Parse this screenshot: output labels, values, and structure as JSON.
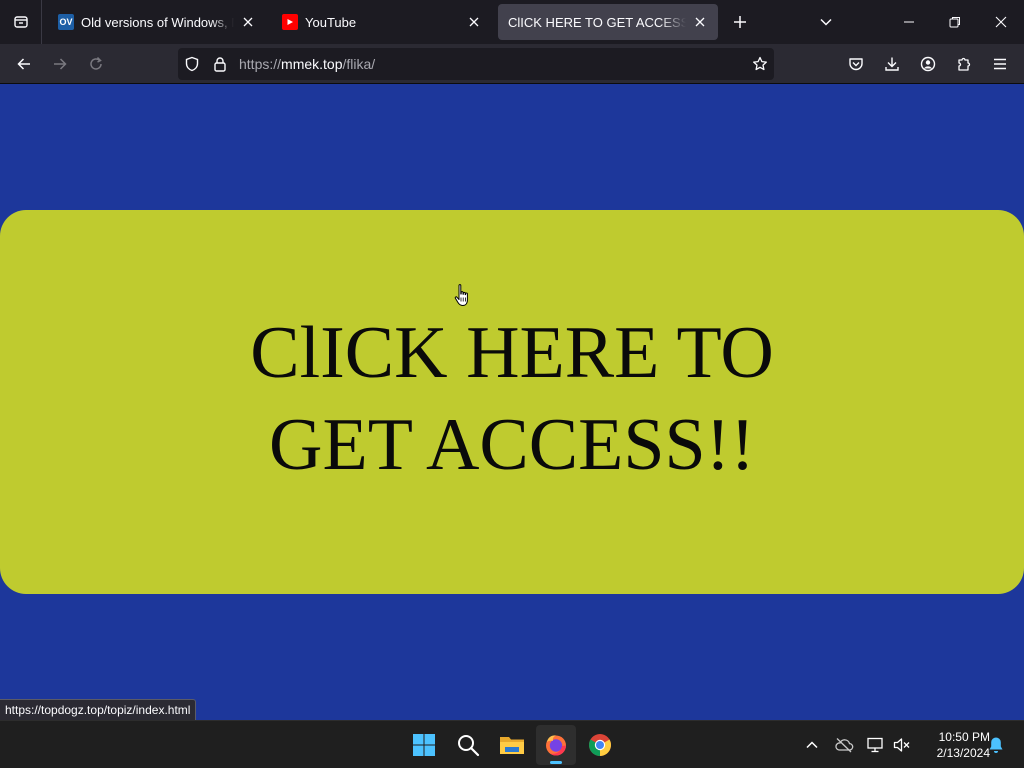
{
  "browser": {
    "tabs": [
      {
        "title": "Old versions of Windows, Mac and",
        "favicon": "oldversion-favicon",
        "favicon_text": "OV",
        "active": false
      },
      {
        "title": "YouTube",
        "favicon": "youtube-favicon",
        "active": false
      },
      {
        "title": "ClICK HERE TO GET ACCESS!!",
        "favicon": "none",
        "active": true
      }
    ],
    "url": {
      "scheme": "https://",
      "host": "mmek.top",
      "path": "/flika/"
    },
    "icons": {
      "back": "back-arrow-icon",
      "forward": "forward-arrow-icon",
      "reload": "reload-icon",
      "pocket": "pocket-icon",
      "downloads": "download-icon",
      "account": "account-icon",
      "extensions": "extensions-icon",
      "menu": "hamburger-menu-icon"
    }
  },
  "page": {
    "cta_text": "ClICK HERE TO GET ACCESS!!",
    "background_color": "#1d379b",
    "cta_color": "#bfcb2f"
  },
  "status": {
    "link_url": "https://topdogz.top/topiz/index.html"
  },
  "taskbar": {
    "apps": [
      "windows-start",
      "search",
      "file-explorer",
      "firefox",
      "chrome"
    ],
    "active_app": "firefox",
    "time": "10:50 PM",
    "date": "2/13/2024"
  },
  "colors": {
    "browser_chrome": "#1c1b22",
    "toolbar": "#2b2a33",
    "active_tab": "#42414d",
    "taskbar": "#1f1f1f",
    "accent": "#4cc2ff"
  }
}
